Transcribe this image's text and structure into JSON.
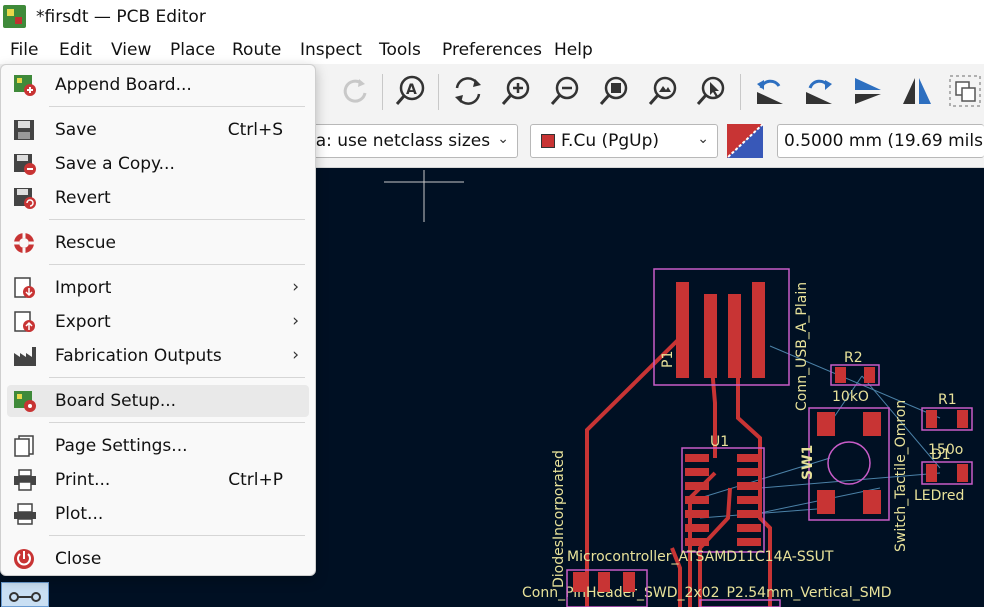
{
  "window": {
    "title": "*firsdt — PCB Editor"
  },
  "menubar": {
    "items": [
      "File",
      "Edit",
      "View",
      "Place",
      "Route",
      "Inspect",
      "Tools",
      "Preferences",
      "Help"
    ]
  },
  "toolbar2": {
    "via_combo": "ia: use netclass sizes",
    "layer_combo": "F.Cu (PgUp)",
    "layer_color": "#c83434",
    "grid_value": "0.5000 mm (19.69 mils)"
  },
  "file_menu": {
    "items": [
      {
        "label": "Append Board...",
        "shortcut": "",
        "submenu": false,
        "icon": "append-board-icon"
      },
      {
        "label": "Save",
        "shortcut": "Ctrl+S",
        "submenu": false,
        "icon": "save-icon"
      },
      {
        "label": "Save a Copy...",
        "shortcut": "",
        "submenu": false,
        "icon": "save-copy-icon"
      },
      {
        "label": "Revert",
        "shortcut": "",
        "submenu": false,
        "icon": "revert-icon"
      },
      {
        "label": "Rescue",
        "shortcut": "",
        "submenu": false,
        "icon": "rescue-icon"
      },
      {
        "label": "Import",
        "shortcut": "",
        "submenu": true,
        "icon": "import-icon"
      },
      {
        "label": "Export",
        "shortcut": "",
        "submenu": true,
        "icon": "export-icon"
      },
      {
        "label": "Fabrication Outputs",
        "shortcut": "",
        "submenu": true,
        "icon": "fabrication-icon"
      },
      {
        "label": "Board Setup...",
        "shortcut": "",
        "submenu": false,
        "icon": "board-setup-icon"
      },
      {
        "label": "Page Settings...",
        "shortcut": "",
        "submenu": false,
        "icon": "page-settings-icon"
      },
      {
        "label": "Print...",
        "shortcut": "Ctrl+P",
        "submenu": false,
        "icon": "print-icon"
      },
      {
        "label": "Plot...",
        "shortcut": "",
        "submenu": false,
        "icon": "plot-icon"
      },
      {
        "label": "Close",
        "shortcut": "",
        "submenu": false,
        "icon": "close-icon"
      }
    ],
    "highlighted": "Board Setup..."
  },
  "pcb": {
    "labels": {
      "p1_ref": "P1",
      "usb_value": "Conn_USB_A_Plain",
      "r2_ref": "R2",
      "r2_value": "10kO",
      "r1_ref": "R1",
      "r1_value": "150o",
      "d1_ref": "D1",
      "d1_value": "LEDred",
      "u1_ref": "U1",
      "sw1_ref": "SW1",
      "sw_value": "Switch_Tactile_Omron",
      "mcu_value": "Microcontroller_ATSAMD11C14A-SSUT",
      "conn_value": "Conn_PinHeader_SWD_2x02_P2.54mm_Vertical_SMD",
      "diodes": "DiodesIncorporated"
    }
  }
}
